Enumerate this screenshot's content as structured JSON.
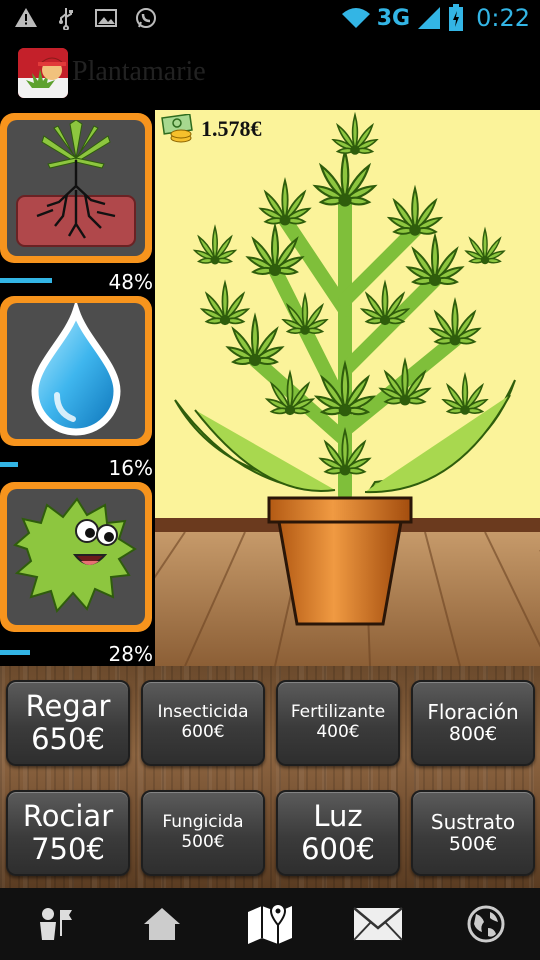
{
  "status_bar": {
    "network": "3G",
    "time": "0:22"
  },
  "app": {
    "title": "Plantamarie"
  },
  "gauges": [
    {
      "name": "roots",
      "percent_label": "48%",
      "level": 0.48
    },
    {
      "name": "water",
      "percent_label": "16%",
      "level": 0.16
    },
    {
      "name": "pest",
      "percent_label": "28%",
      "level": 0.28
    }
  ],
  "money": "1.578€",
  "buttons": [
    {
      "l1": "Regar",
      "l2": "650€"
    },
    {
      "l1": "Insecticida",
      "l2": "600€"
    },
    {
      "l1": "Fertilizante",
      "l2": "400€"
    },
    {
      "l1": "Floración",
      "l2": "800€"
    },
    {
      "l1": "Rociar",
      "l2": "750€"
    },
    {
      "l1": "Fungicida",
      "l2": "500€"
    },
    {
      "l1": "Luz",
      "l2": "600€"
    },
    {
      "l1": "Sustrato",
      "l2": "500€"
    }
  ],
  "nav": [
    "character-icon",
    "home-icon",
    "map-icon",
    "mail-icon",
    "globe-icon"
  ],
  "colors": {
    "accent": "#33b5e5",
    "gauge_frame": "#f7941d",
    "leaf": "#8dc63f"
  }
}
